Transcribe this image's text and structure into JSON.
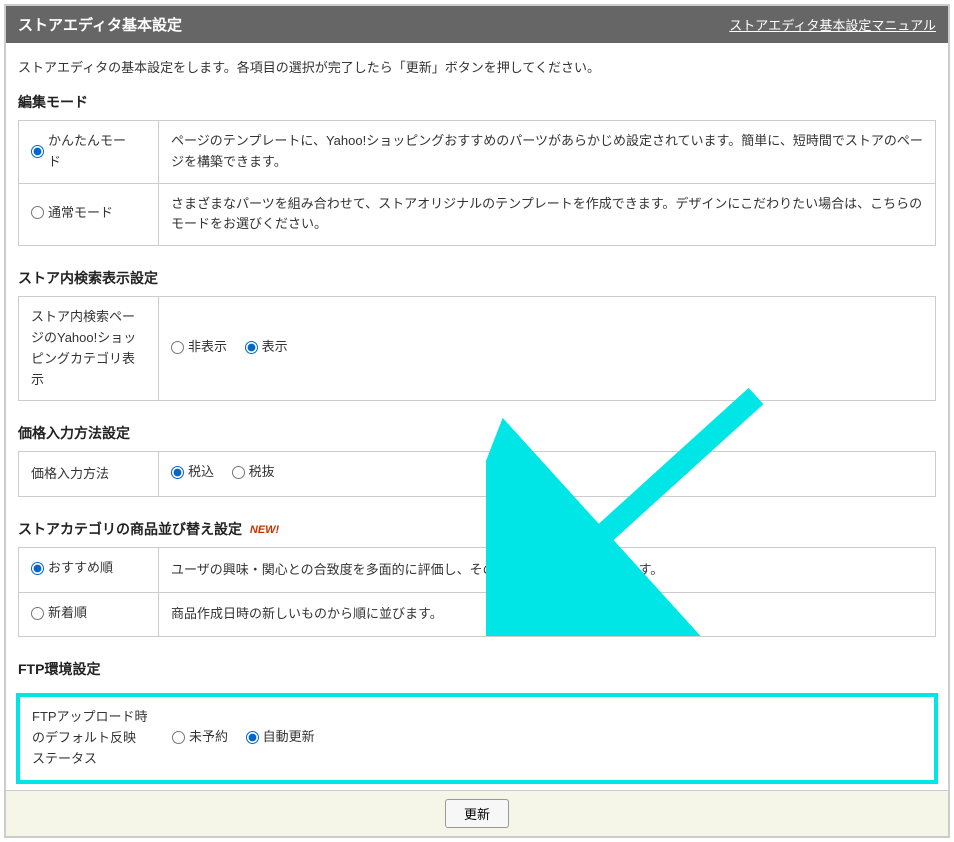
{
  "header": {
    "title": "ストアエディタ基本設定",
    "manual_link": "ストアエディタ基本設定マニュアル"
  },
  "intro": "ストアエディタの基本設定をします。各項目の選択が完了したら「更新」ボタンを押してください。",
  "edit_mode": {
    "title": "編集モード",
    "easy_label": "かんたんモード",
    "easy_desc": "ページのテンプレートに、Yahoo!ショッピングおすすめのパーツがあらかじめ設定されています。簡単に、短時間でストアのページを構築できます。",
    "normal_label": "通常モード",
    "normal_desc": "さまざまなパーツを組み合わせて、ストアオリジナルのテンプレートを作成できます。デザインにこだわりたい場合は、こちらのモードをお選びください。"
  },
  "search_display": {
    "title": "ストア内検索表示設定",
    "row_label": "ストア内検索ページのYahoo!ショッピングカテゴリ表示",
    "opt_hide": "非表示",
    "opt_show": "表示"
  },
  "price_input": {
    "title": "価格入力方法設定",
    "row_label": "価格入力方法",
    "opt_incl": "税込",
    "opt_excl": "税抜"
  },
  "sort": {
    "title": "ストアカテゴリの商品並び替え設定",
    "new_badge": "NEW!",
    "rec_label": "おすすめ順",
    "rec_desc": "ユーザの興味・関心との合致度を多面的に評価し、そのスコアの高い順で並びます。",
    "new_label": "新着順",
    "new_desc": "商品作成日時の新しいものから順に並びます。"
  },
  "ftp": {
    "title": "FTP環境設定",
    "row_label": "FTPアップロード時のデフォルト反映ステータス",
    "opt_unreserved": "未予約",
    "opt_auto": "自動更新"
  },
  "footer": {
    "update_btn": "更新"
  }
}
